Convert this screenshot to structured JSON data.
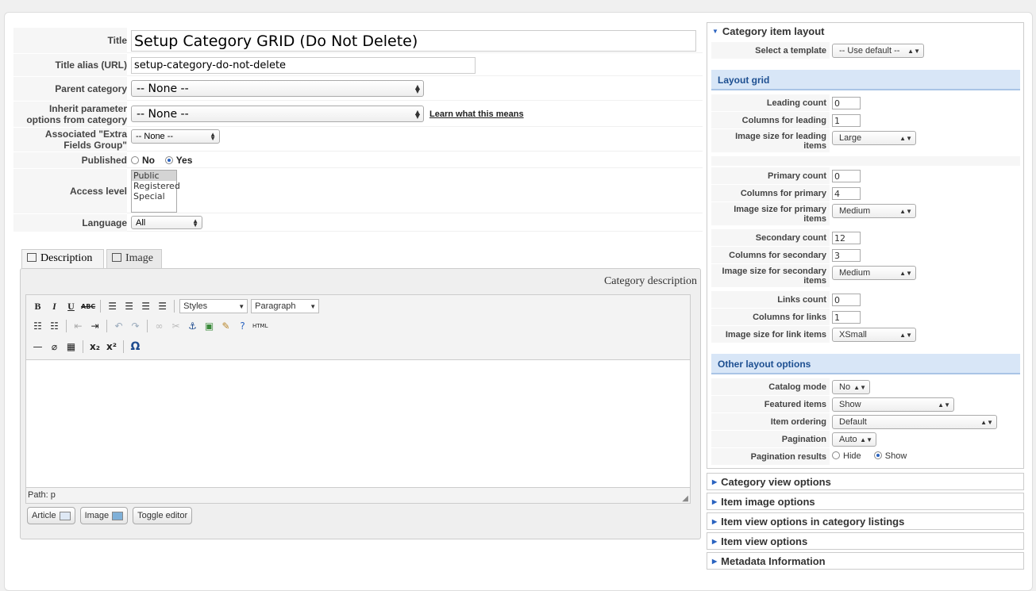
{
  "form": {
    "title_label": "Title",
    "title_value": "Setup Category GRID (Do Not Delete)",
    "alias_label": "Title alias (URL)",
    "alias_value": "setup-category-do-not-delete",
    "parent_label": "Parent category",
    "parent_value": "-- None --",
    "inherit_label_1": "Inherit parameter",
    "inherit_label_2": "options from category",
    "inherit_value": "-- None --",
    "learn_link": "Learn what this means",
    "extra_label_1": "Associated \"Extra",
    "extra_label_2": "Fields Group\"",
    "extra_value": "-- None --",
    "published_label": "Published",
    "published_no": "No",
    "published_yes": "Yes",
    "published_selected": "Yes",
    "access_label": "Access level",
    "access_options": [
      "Public",
      "Registered",
      "Special"
    ],
    "access_selected": "Public",
    "language_label": "Language",
    "language_value": "All"
  },
  "tabs": {
    "description": "Description",
    "image": "Image",
    "active": "Description"
  },
  "editor": {
    "title": "Category description",
    "styles_label": "Styles",
    "format_label": "Paragraph",
    "bold": "B",
    "italic": "I",
    "underline": "U",
    "strike": "ABC",
    "html": "HTML",
    "omega": "Ω",
    "path": "Path: p",
    "article_button": "Article",
    "image_button": "Image",
    "toggle_button": "Toggle editor"
  },
  "sidebar": {
    "category_item_layout": "Category item layout",
    "select_template_label": "Select a template",
    "select_template_value": "-- Use default --",
    "layout_grid": "Layout grid",
    "leading_count_label": "Leading count",
    "leading_count": "0",
    "columns_leading_label": "Columns for leading",
    "columns_leading": "1",
    "image_leading_label": "Image size for leading items",
    "image_leading": "Large",
    "primary_count_label": "Primary count",
    "primary_count": "0",
    "columns_primary_label": "Columns for primary",
    "columns_primary": "4",
    "image_primary_label": "Image size for primary items",
    "image_primary": "Medium",
    "secondary_count_label": "Secondary count",
    "secondary_count": "12",
    "columns_secondary_label": "Columns for secondary",
    "columns_secondary": "3",
    "image_secondary_label": "Image size for secondary items",
    "image_secondary": "Medium",
    "links_count_label": "Links count",
    "links_count": "0",
    "columns_links_label": "Columns for links",
    "columns_links": "1",
    "image_links_label": "Image size for link items",
    "image_links": "XSmall",
    "other_layout": "Other layout options",
    "catalog_mode_label": "Catalog mode",
    "catalog_mode": "No",
    "featured_label": "Featured items",
    "featured": "Show",
    "ordering_label": "Item ordering",
    "ordering": "Default",
    "pagination_label": "Pagination",
    "pagination": "Auto",
    "pagination_results_label": "Pagination results",
    "pagination_hide": "Hide",
    "pagination_show": "Show",
    "pagination_results_selected": "Show",
    "collapsed": [
      "Category view options",
      "Item image options",
      "Item view options in category listings",
      "Item view options",
      "Metadata Information"
    ]
  },
  "colors": {
    "section_bg": "#d8e6f7",
    "section_text": "#1d4f91",
    "accent": "#2a63c0"
  }
}
